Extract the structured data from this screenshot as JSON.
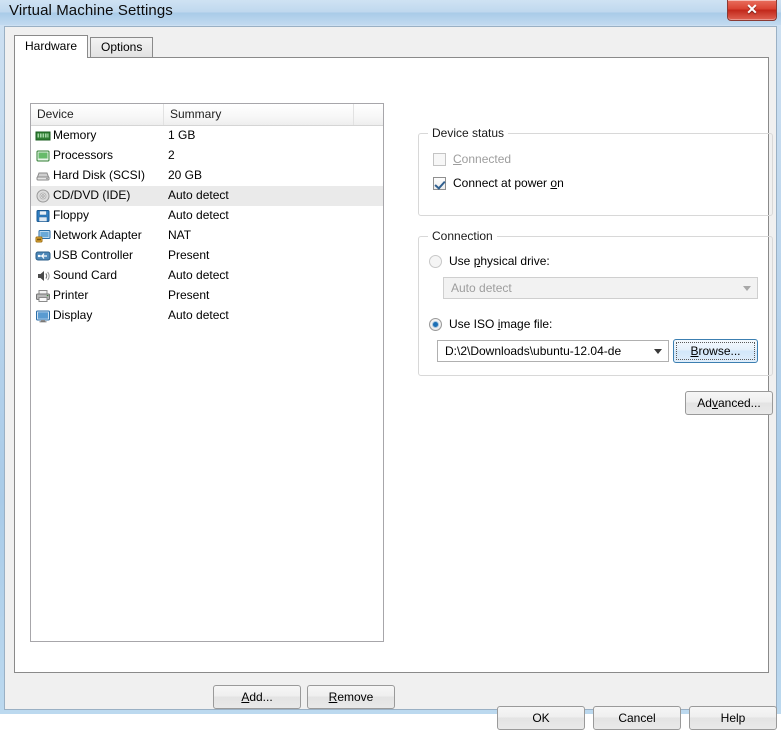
{
  "window": {
    "title": "Virtual Machine Settings",
    "close_label": "✕"
  },
  "tabs": [
    {
      "label": "Hardware",
      "active": true
    },
    {
      "label": "Options",
      "active": false
    }
  ],
  "device_list": {
    "columns": [
      "Device",
      "Summary",
      ""
    ],
    "rows": [
      {
        "name": "Memory",
        "summary": "1 GB",
        "icon": "memory-icon",
        "selected": false
      },
      {
        "name": "Processors",
        "summary": "2",
        "icon": "processor-icon",
        "selected": false
      },
      {
        "name": "Hard Disk (SCSI)",
        "summary": "20 GB",
        "icon": "harddisk-icon",
        "selected": false
      },
      {
        "name": "CD/DVD (IDE)",
        "summary": "Auto detect",
        "icon": "cddvd-icon",
        "selected": true
      },
      {
        "name": "Floppy",
        "summary": "Auto detect",
        "icon": "floppy-icon",
        "selected": false
      },
      {
        "name": "Network Adapter",
        "summary": "NAT",
        "icon": "network-adapter-icon",
        "selected": false
      },
      {
        "name": "USB Controller",
        "summary": "Present",
        "icon": "usb-icon",
        "selected": false
      },
      {
        "name": "Sound Card",
        "summary": "Auto detect",
        "icon": "sound-card-icon",
        "selected": false
      },
      {
        "name": "Printer",
        "summary": "Present",
        "icon": "printer-icon",
        "selected": false
      },
      {
        "name": "Display",
        "summary": "Auto detect",
        "icon": "display-icon",
        "selected": false
      }
    ]
  },
  "list_buttons": {
    "add": "Add...",
    "remove": "Remove"
  },
  "device_status": {
    "title": "Device status",
    "connected": {
      "label": "Connected",
      "checked": false,
      "disabled": true
    },
    "connect_at_power_on": {
      "label": "Connect at power on",
      "checked": true,
      "disabled": false
    }
  },
  "connection": {
    "title": "Connection",
    "use_physical_drive": {
      "label": "Use physical drive:",
      "selected": false,
      "disabled": true
    },
    "physical_drive_value": "Auto detect",
    "use_iso_image": {
      "label": "Use ISO image file:",
      "selected": true,
      "disabled": false
    },
    "iso_path_value": "D:\\2\\Downloads\\ubuntu-12.04-de",
    "browse_label": "Browse...",
    "advanced_label": "Advanced..."
  },
  "footer": {
    "ok": "OK",
    "cancel": "Cancel",
    "help": "Help"
  },
  "colors": {
    "titlebar_blue": "#b9d4ec",
    "close_red": "#d94232",
    "selection_grey": "#eaeaea",
    "focus_blue": "#3c7fb1"
  }
}
